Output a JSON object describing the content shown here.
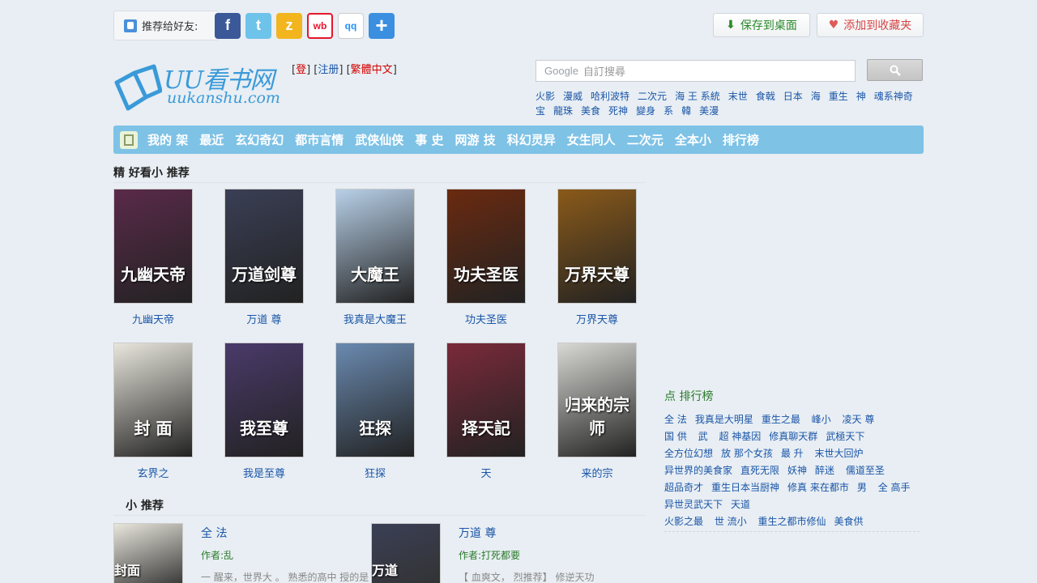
{
  "share": {
    "label": "推荐给好友:",
    "icons": [
      "f",
      "t",
      "z",
      "wb",
      "qq",
      "+"
    ]
  },
  "top_buttons": {
    "desktop": "保存到桌面",
    "favorite": "添加到收藏夹"
  },
  "logo": {
    "main": "UU看书网",
    "sub": "uukanshu.com"
  },
  "user_links": {
    "login": "登",
    "register": "注册",
    "traditional": "繁體中文"
  },
  "search": {
    "brand": "Google",
    "placeholder": "自訂搜尋"
  },
  "hot_words": [
    "火影",
    "漫威",
    "哈利波特",
    "二次元",
    "海 王 系統",
    "末世",
    "食戟",
    "日本",
    "海",
    "重生",
    "神",
    "魂系神奇宝",
    "龍珠",
    "美食",
    "死神",
    "變身",
    "系",
    "韓",
    "美漫"
  ],
  "nav": [
    "我的 架",
    "最近",
    "玄幻奇幻",
    "都市言情",
    "武侠仙侠",
    "事 史",
    "网游 技",
    "科幻灵异",
    "女生同人",
    "二次元",
    "全本小",
    "排行榜"
  ],
  "section1_title": "精 好看小 推荐",
  "books": [
    {
      "title": "九幽天帝",
      "cover_text": "九幽天帝",
      "color": "#5a2a4a"
    },
    {
      "title": "万道 尊",
      "cover_text": "万道剑尊",
      "color": "#3a3f55"
    },
    {
      "title": "我真是大魔王",
      "cover_text": "大魔王",
      "color": "#b8d0e8"
    },
    {
      "title": "功夫圣医",
      "cover_text": "功夫圣医",
      "color": "#6a2a10"
    },
    {
      "title": "万界天尊",
      "cover_text": "万界天尊",
      "color": "#8a5a1a"
    },
    {
      "title": "玄界之",
      "cover_text": "封 面",
      "color": "#e8e6dc"
    },
    {
      "title": "我是至尊",
      "cover_text": "我至尊",
      "color": "#4a3a6a"
    },
    {
      "title": "狂探",
      "cover_text": "狂探",
      "color": "#6a8ab0"
    },
    {
      "title": "天",
      "cover_text": "择天記",
      "color": "#7a2a3a"
    },
    {
      "title": "来的宗",
      "cover_text": "归来的宗师",
      "color": "#d8d8d4"
    }
  ],
  "section2_title": "小 推荐",
  "recs": [
    {
      "title": "全 法",
      "author": "作者:乱",
      "desc": "一 醒来，世界大 。 熟悉的高中 授的是",
      "color": "#e8e6dc",
      "cover_text": "封面"
    },
    {
      "title": "万道 尊",
      "author": "作者:打死都要",
      "desc": "【 血爽文， 烈推荐】 修逆天功",
      "color": "#3a3f55",
      "cover_text": "万道"
    }
  ],
  "rank_title": "点 排行榜",
  "rank_items": [
    "全 法",
    "我真是大明星",
    "重生之最 ",
    "峰小 ",
    "凌天 尊",
    "国 供 ",
    "武 ",
    "超 神基因",
    "修真聊天群",
    "武極天下",
    "全方位幻想",
    "放 那个女孩",
    "最 升 ",
    "末世大回炉",
    "异世界的美食家",
    "直死无限",
    "妖神",
    "醉迷 ",
    "儒道至圣",
    "超品奇才",
    "重生日本当厨神",
    "修真 来在都市",
    "男 ",
    "全 高手",
    "异世灵武天下",
    "天道",
    "火影之最 ",
    "世 流小 ",
    "重生之都市修仙",
    "美食供 "
  ]
}
